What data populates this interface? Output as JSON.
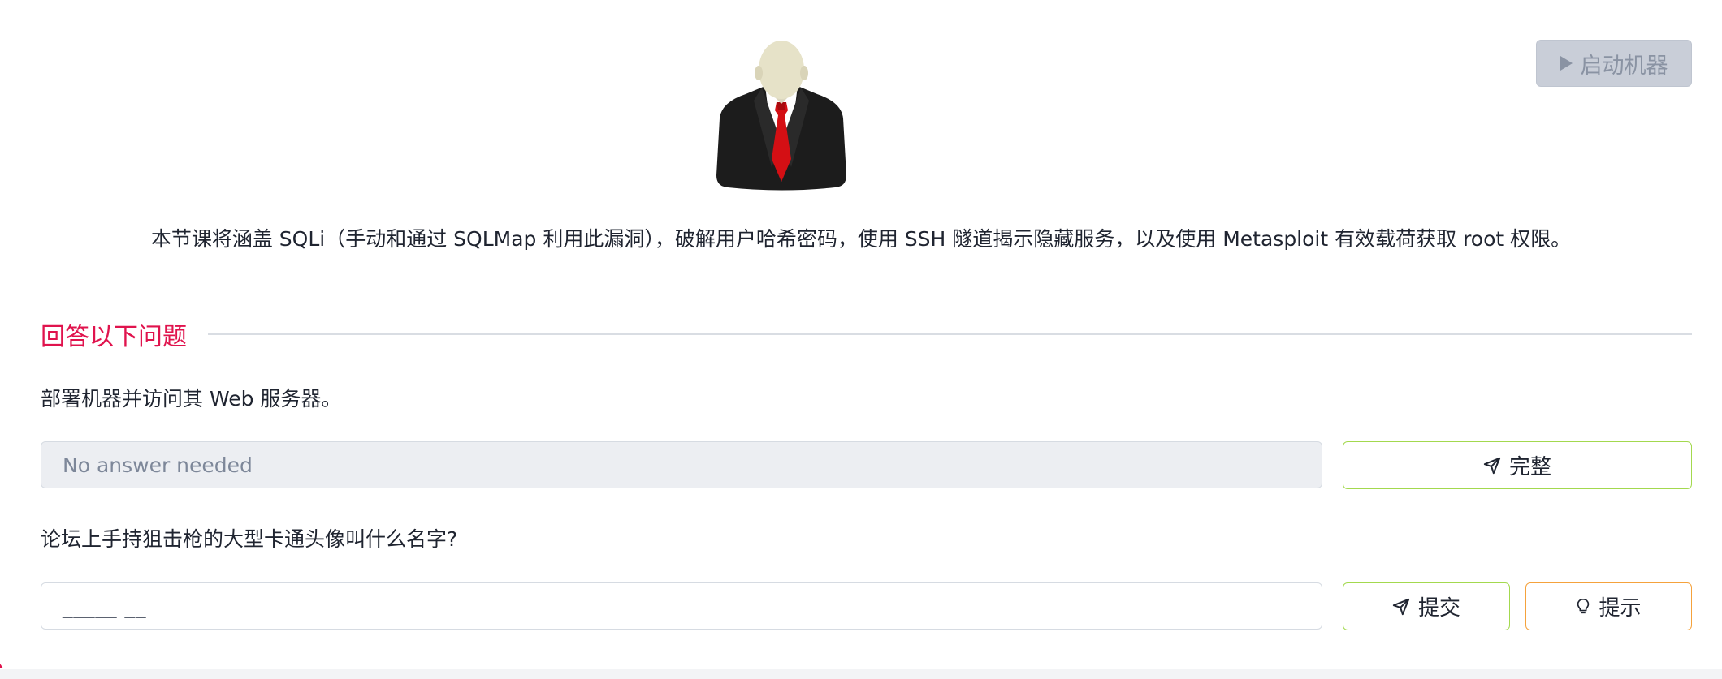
{
  "header": {
    "start_machine_label": "启动机器"
  },
  "intro": {
    "text": "本节课将涵盖 SQLi（手动和通过 SQLMap 利用此漏洞），破解用户哈希密码，使用 SSH 隧道揭示隐藏服务，以及使用 Metasploit 有效载荷获取 root 权限。"
  },
  "questions_section": {
    "title": "回答以下问题",
    "questions": [
      {
        "text": "部署机器并访问其 Web 服务器。",
        "answer_value": "No answer needed",
        "button_label": "完整"
      },
      {
        "text": "论坛上手持狙击枪的大型卡通头像叫什么名字?",
        "answer_placeholder": "_____ __",
        "submit_label": "提交",
        "hint_label": "提示"
      }
    ]
  },
  "colors": {
    "accent": "#e0134d",
    "success_border": "#a3d94e",
    "hint_border": "#f5a23c",
    "disabled_bg": "#c9ced8"
  },
  "icons": {
    "play": "play-icon",
    "send": "paper-plane-icon",
    "hint": "lightbulb-icon"
  }
}
